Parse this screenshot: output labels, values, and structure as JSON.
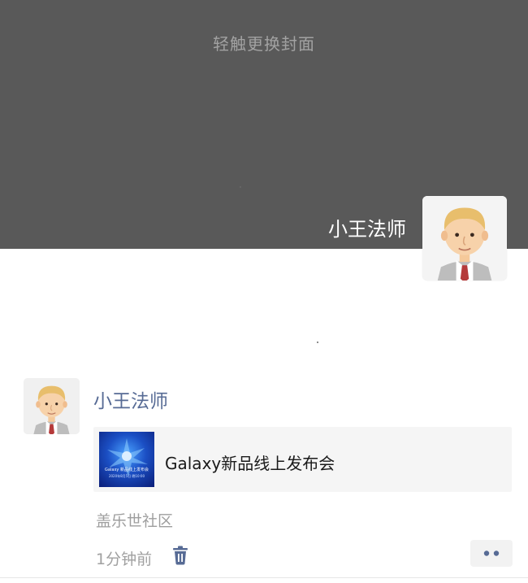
{
  "cover": {
    "hint": "轻触更换封面",
    "background_color": "#595959"
  },
  "profile": {
    "name": "小王法师",
    "avatar_icon": "cartoon-man-avatar"
  },
  "post": {
    "author": "小王法师",
    "avatar_icon": "cartoon-man-avatar",
    "share": {
      "title": "Galaxy新品线上发布会",
      "thumbnail_title": "Galaxy 新品线上发布会",
      "thumbnail_subtitle": "2020年8月5日 晚10:00"
    },
    "source": "盖乐世社区",
    "time": "1分钟前",
    "delete_icon": "trash-icon",
    "more_icon": "more-dots-icon"
  },
  "colors": {
    "author_link": "#576b95",
    "card_background": "#f5f5f5"
  }
}
